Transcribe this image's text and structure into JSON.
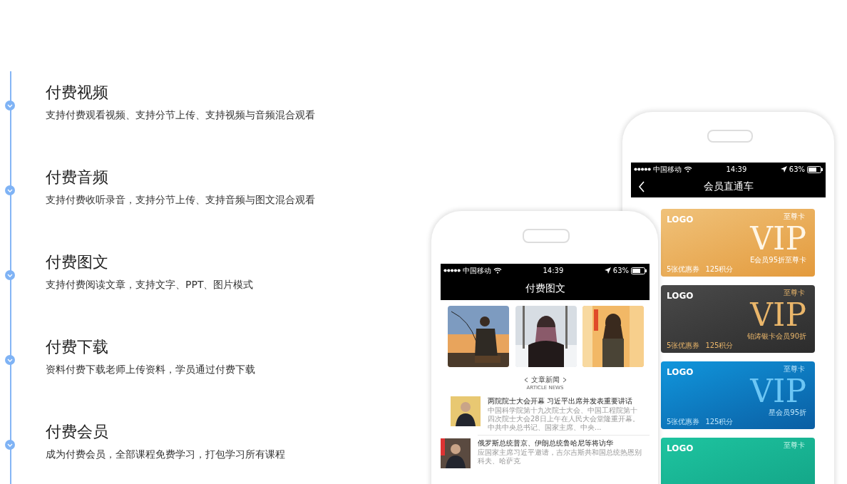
{
  "features": [
    {
      "title": "付费视频",
      "description": "支持付费观看视频、支持分节上传、支持视频与音频混合观看"
    },
    {
      "title": "付费音频",
      "description": "支持付费收听录音，支持分节上传、支持音频与图文混合观看"
    },
    {
      "title": "付费图文",
      "description": "支持付费阅读文章，支持文字、PPT、图片模式"
    },
    {
      "title": "付费下载",
      "description": "资料付费下载老师上传资料，学员通过付费下载"
    },
    {
      "title": "付费会员",
      "description": "成为付费会员，全部课程免费学习，打包学习所有课程"
    }
  ],
  "member_phone": {
    "status_bar": {
      "carrier": "中国移动",
      "time": "14:39",
      "battery": "63%"
    },
    "title": "会员直通车",
    "cards": [
      {
        "kind": "gold",
        "logo": "LOGO",
        "tier": "至尊卡",
        "vip": "VIP",
        "perk": "E会员95折至尊卡",
        "coupons": "5张优惠券",
        "points": "125积分"
      },
      {
        "kind": "dark",
        "logo": "LOGO",
        "tier": "至尊卡",
        "vip": "VIP",
        "perk": "铂涛银卡会员90折",
        "coupons": "5张优惠券",
        "points": "125积分"
      },
      {
        "kind": "blue",
        "logo": "LOGO",
        "tier": "至尊卡",
        "vip": "VIP",
        "perk": "星会员95折",
        "coupons": "5张优惠券",
        "points": "125积分"
      },
      {
        "kind": "green",
        "logo": "LOGO",
        "tier": "至尊卡"
      }
    ]
  },
  "article_phone": {
    "status_bar": {
      "carrier": "中国移动",
      "time": "14:39",
      "battery": "63%"
    },
    "title": "付费图文",
    "section": {
      "title": "文章新闻",
      "subtitle": "ARTICLE NEWS"
    },
    "news": [
      {
        "title": "两院院士大会开幕 习近平出席并发表重要讲话",
        "summary": "中国科学院第十九次院士大会、中国工程院第十四次院士大会28日上午在人民大会堂隆重开幕。中共中央总书记、国家主席、中央..."
      },
      {
        "title": "俄罗斯总统普京、伊朗总统鲁哈尼等将访华",
        "summary": "应国家主席习近平邀请，吉尔吉斯共和国总统热恩别科夫、哈萨克"
      }
    ]
  }
}
